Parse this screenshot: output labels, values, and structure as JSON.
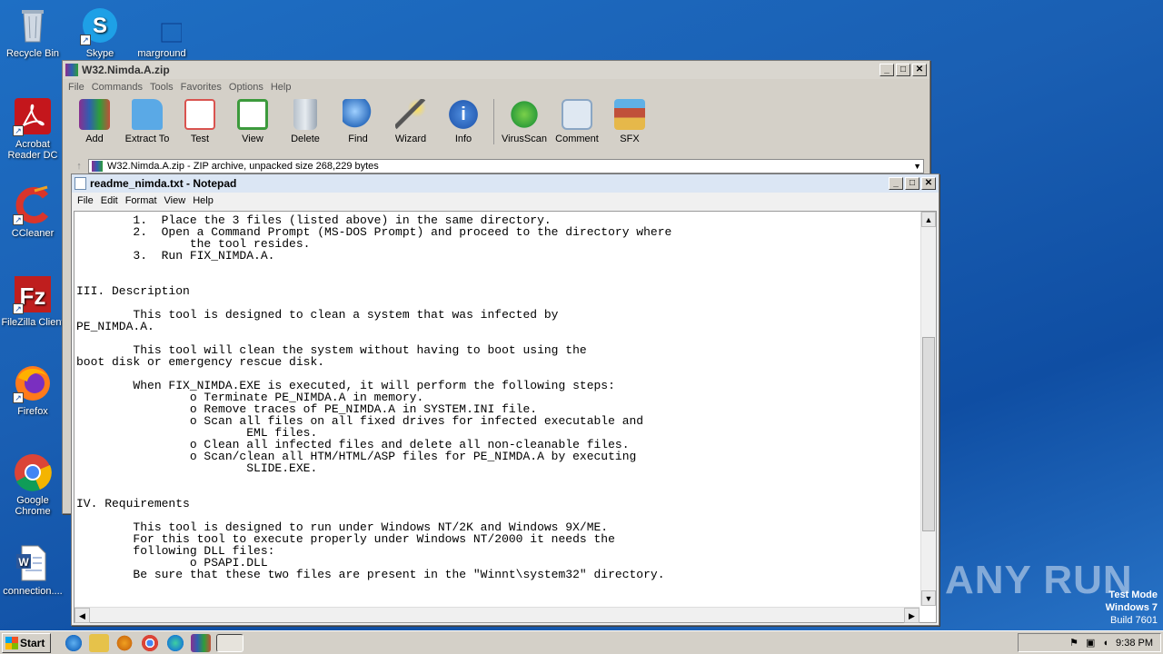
{
  "desktop": {
    "icons": [
      {
        "label": "Recycle Bin",
        "icon": "recycle-bin-icon"
      },
      {
        "label": "Skype",
        "icon": "skype-icon"
      },
      {
        "label": "marground",
        "icon": "file-icon"
      },
      {
        "label": "Acrobat Reader DC",
        "icon": "acrobat-icon"
      },
      {
        "label": "CCleaner",
        "icon": "ccleaner-icon"
      },
      {
        "label": "FileZilla Client",
        "icon": "filezilla-icon"
      },
      {
        "label": "Firefox",
        "icon": "firefox-icon"
      },
      {
        "label": "Google Chrome",
        "icon": "chrome-icon"
      },
      {
        "label": "connection....",
        "icon": "word-doc-icon"
      }
    ]
  },
  "winrar": {
    "title": "W32.Nimda.A.zip",
    "menu": [
      "File",
      "Commands",
      "Tools",
      "Favorites",
      "Options",
      "Help"
    ],
    "tools": [
      {
        "label": "Add",
        "color": "#b33c2e"
      },
      {
        "label": "Extract To",
        "color": "#3a8fd6"
      },
      {
        "label": "Test",
        "color": "#d9534f"
      },
      {
        "label": "View",
        "color": "#3c9a3c"
      },
      {
        "label": "Delete",
        "color": "#8a96a3"
      },
      {
        "label": "Find",
        "color": "#2f6fc0"
      },
      {
        "label": "Wizard",
        "color": "#e0b020"
      },
      {
        "label": "Info",
        "color": "#2a62b8"
      },
      {
        "label": "VirusScan",
        "color": "#2f9e3a"
      },
      {
        "label": "Comment",
        "color": "#8aa6c4"
      },
      {
        "label": "SFX",
        "color": "#c0503a"
      }
    ],
    "path": "W32.Nimda.A.zip - ZIP archive, unpacked size 268,229 bytes"
  },
  "notepad": {
    "title": "readme_nimda.txt - Notepad",
    "menu": [
      "File",
      "Edit",
      "Format",
      "View",
      "Help"
    ],
    "lines": [
      "        1.  Place the 3 files (listed above) in the same directory.",
      "        2.  Open a Command Prompt (MS-DOS Prompt) and proceed to the directory where",
      "                the tool resides.",
      "        3.  Run FIX_NIMDA.A.",
      "",
      "",
      "III. Description",
      "",
      "        This tool is designed to clean a system that was infected by",
      "PE_NIMDA.A.",
      "",
      "        This tool will clean the system without having to boot using the",
      "boot disk or emergency rescue disk.",
      "",
      "        When FIX_NIMDA.EXE is executed, it will perform the following steps:",
      "                o Terminate PE_NIMDA.A in memory.",
      "                o Remove traces of PE_NIMDA.A in SYSTEM.INI file.",
      "                o Scan all files on all fixed drives for infected executable and",
      "                        EML files.",
      "                o Clean all infected files and delete all non-cleanable files.",
      "                o Scan/clean all HTM/HTML/ASP files for PE_NIMDA.A by executing",
      "                        SLIDE.EXE.",
      "",
      "",
      "IV. Requirements",
      "",
      "        This tool is designed to run under Windows NT/2K and Windows 9X/ME.",
      "        For this tool to execute properly under Windows NT/2000 it needs the",
      "        following DLL files:",
      "                o PSAPI.DLL",
      "        Be sure that these two files are present in the \"Winnt\\system32\" directory."
    ]
  },
  "taskbar": {
    "start_label": "Start",
    "clock": "9:38 PM"
  },
  "watermark": {
    "brand": "ANY RUN",
    "mode": "Test Mode",
    "os": "Windows 7",
    "build": "Build 7601"
  }
}
